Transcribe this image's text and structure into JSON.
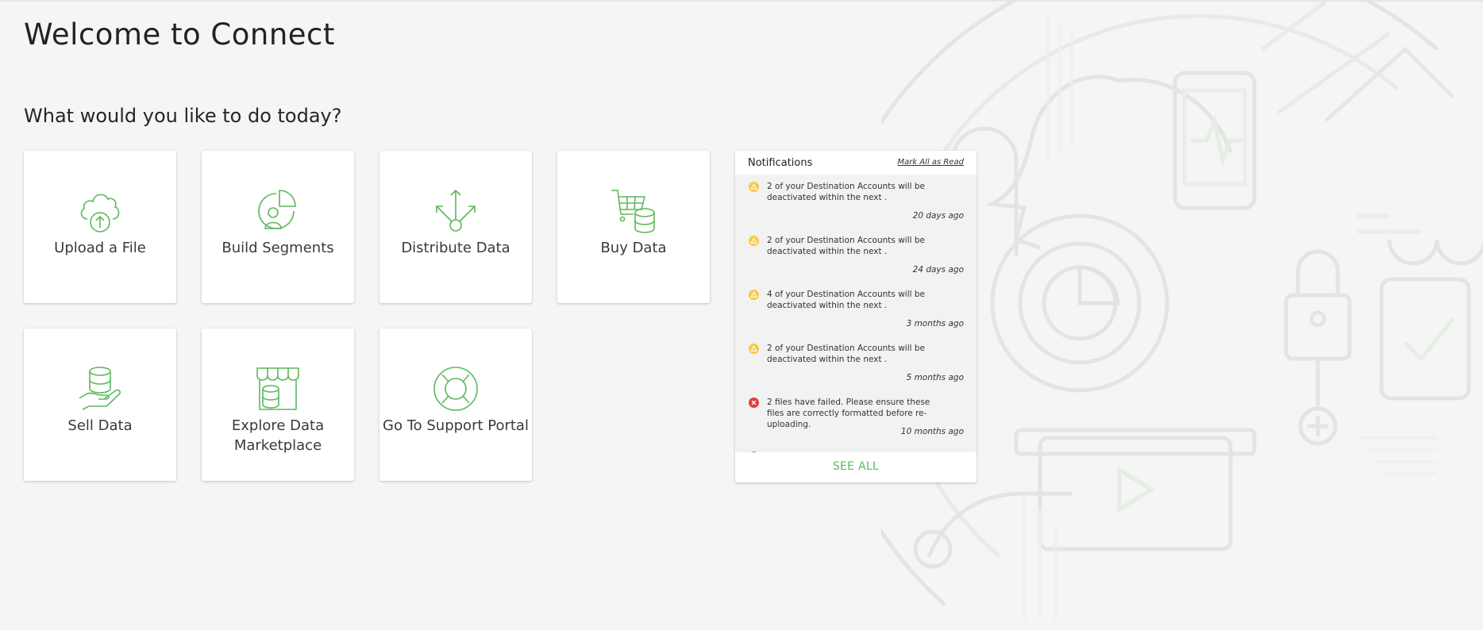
{
  "page": {
    "title": "Welcome to Connect",
    "subtitle": "What would you like to do today?"
  },
  "colors": {
    "accent": "#5cb85c",
    "warning": "#f7c948",
    "error": "#e03e3e"
  },
  "tiles": [
    {
      "label": "Upload a File",
      "icon": "cloud-upload-icon"
    },
    {
      "label": "Build Segments",
      "icon": "segments-pie-icon"
    },
    {
      "label": "Distribute Data",
      "icon": "distribute-arrows-icon"
    },
    {
      "label": "Buy Data",
      "icon": "shopping-cart-database-icon"
    },
    {
      "label": "Sell Data",
      "icon": "hand-database-icon"
    },
    {
      "label": "Explore Data Marketplace",
      "icon": "storefront-database-icon"
    },
    {
      "label": "Go To Support Portal",
      "icon": "lifebuoy-icon"
    }
  ],
  "notifications": {
    "title": "Notifications",
    "mark_all_read": "Mark All as Read",
    "see_all": "SEE ALL",
    "items": [
      {
        "type": "warning",
        "icon": "warning-icon",
        "message": "2 of your Destination Accounts will be deactivated within the next .",
        "time": "20 days ago"
      },
      {
        "type": "warning",
        "icon": "warning-icon",
        "message": "2 of your Destination Accounts will be deactivated within the next .",
        "time": "24 days ago"
      },
      {
        "type": "warning",
        "icon": "warning-icon",
        "message": "4 of your Destination Accounts will be deactivated within the next .",
        "time": "3 months ago"
      },
      {
        "type": "warning",
        "icon": "warning-icon",
        "message": "2 of your Destination Accounts will be deactivated within the next .",
        "time": "5 months ago"
      },
      {
        "type": "error",
        "icon": "error-icon",
        "message": "2 files have failed. Please ensure these files are correctly formatted before re-uploading.",
        "time": "10 months ago"
      }
    ]
  }
}
